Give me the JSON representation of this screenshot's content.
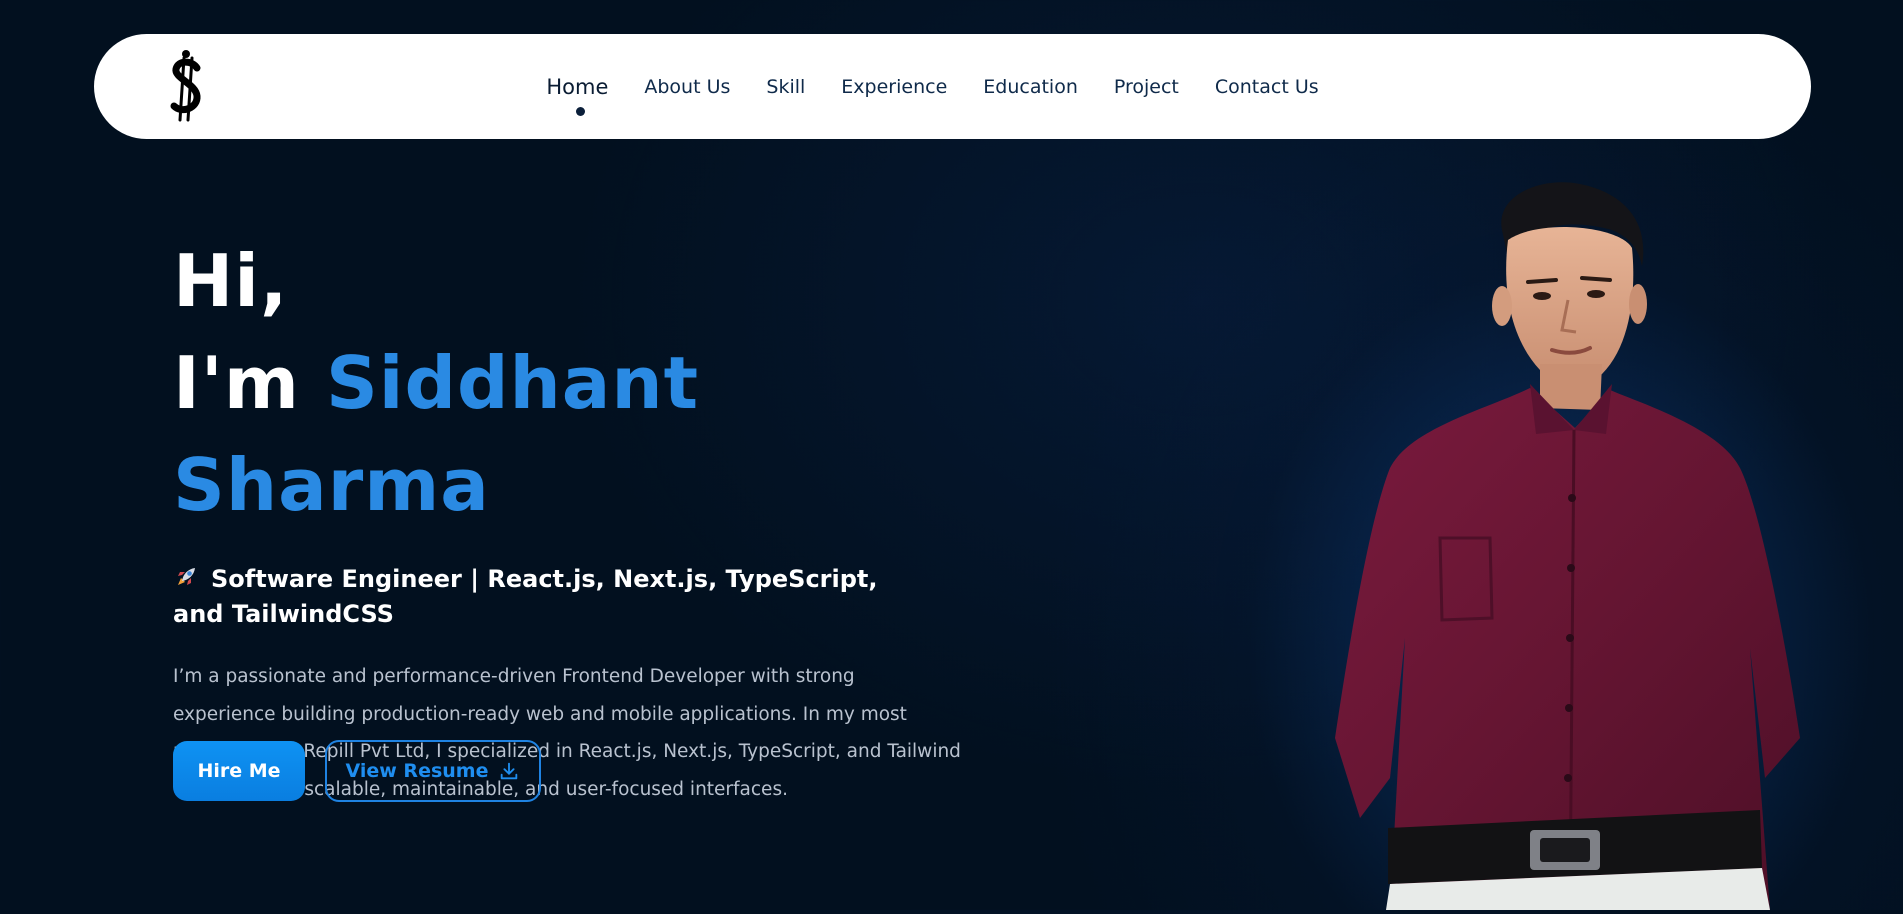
{
  "nav": {
    "logo_icon": "dollar-stylized-logo",
    "items": [
      {
        "label": "Home",
        "active": true
      },
      {
        "label": "About Us"
      },
      {
        "label": "Skill"
      },
      {
        "label": "Experience"
      },
      {
        "label": "Education"
      },
      {
        "label": "Project"
      },
      {
        "label": "Contact Us"
      }
    ]
  },
  "hero": {
    "greeting": "Hi,",
    "intro_prefix": "I'm",
    "name": "Siddhant Sharma",
    "role_icon": "rocket-icon",
    "role": "Software Engineer | React.js, Next.js, TypeScript, and TailwindCSS",
    "bio": "I’m a passionate and performance-driven Frontend Developer with strong experience building production-ready web and mobile applications. In my most recent role at Repill Pvt Ltd, I specialized in React.js, Next.js, TypeScript, and Tailwind CSS to create scalable, maintainable, and user-focused interfaces.",
    "hire_label": "Hire Me",
    "resume_label": "View Resume",
    "resume_icon": "download-icon"
  },
  "colors": {
    "background": "#02101f",
    "accent": "#2a8ae3",
    "button_primary": "#0e92f3",
    "nav_text": "#0f2a4a"
  }
}
